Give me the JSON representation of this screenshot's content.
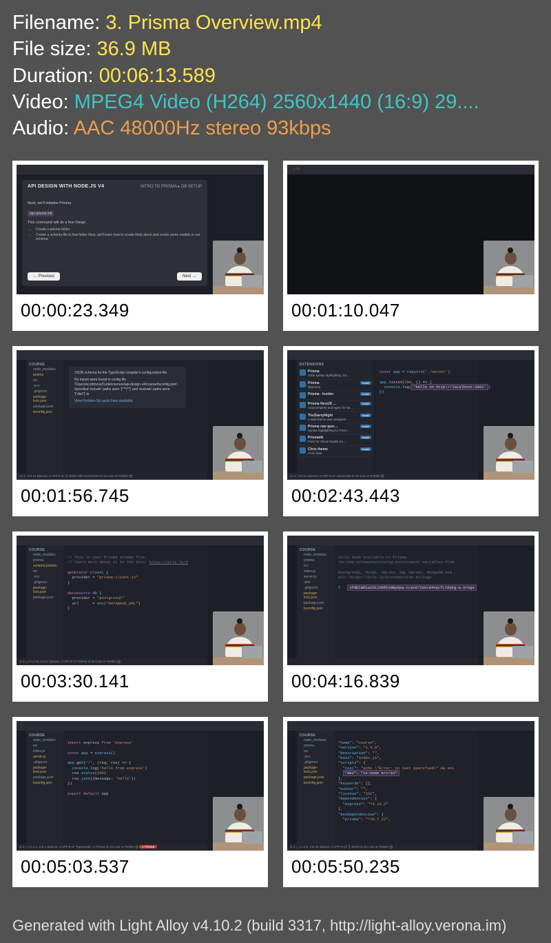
{
  "header": {
    "filename_label": "Filename: ",
    "filename_value": "3. Prisma Overview.mp4",
    "filesize_label": "File size: ",
    "filesize_value": "36.9 MB",
    "duration_label": "Duration: ",
    "duration_value": "00:06:13.589",
    "video_label": "Video: ",
    "video_value": "MPEG4 Video (H264) 2560x1440 (16:9) 29....",
    "audio_label": "Audio: ",
    "audio_value": "AAC 48000Hz stereo 93kbps"
  },
  "slide1": {
    "title": "API DESIGN WITH NODE.JS V4",
    "crumb": "INTRO TO PRISMA ▸ DB SETUP",
    "subtitle": "Next, we'll initalize Prisma",
    "cmd": "npx prisma init",
    "lead": "This command will do a few things:",
    "li1": "Create a prisma folder",
    "li2": "Create a schema file in that folder Next, we'll learn how to create think about and create some models in our schema",
    "prev": "← Previous",
    "next": "Next →"
  },
  "slide2": {
    "term": "~ %"
  },
  "slide3": {
    "tooltip_title": "JSON schema for the TypeScript compiler's configuration file",
    "tooltip_body1": "No inputs were found in config file '/Users/scottmoss/Code/courses/api-design-v4/course/tsconfig.json'. Specified 'include' paths were '[\"**/*\"]' and 'exclude' paths were '[\"dist\"]'.ts",
    "tooltip_link": "View Problem   No quick fixes available",
    "status": "Ln 4, Col 14   Spaces: 2   UTF-8   LF   {} JSON with Comments   ⊘ Go Live   ⊘ Prettier   ⨁"
  },
  "slide4": {
    "ext_header": "EXTENSIONS",
    "items": [
      {
        "name": "Prisma",
        "desc": "Adds syntax highlighting, for…",
        "btn": ""
      },
      {
        "name": "Prisma",
        "desc": "@prisma",
        "btn": "Install"
      },
      {
        "name": "Prisma - Insider",
        "desc": "",
        "btn": "Install"
      },
      {
        "name": "Prisma NestJS …",
        "desc": "Autocomplete and types for Ne…",
        "btn": "Install"
      },
      {
        "name": "TheStarryNight",
        "desc": "A dark theme was designed …",
        "btn": "Install"
      },
      {
        "name": "Prisma raw quer…",
        "desc": "Syntax highlighting for Prism…",
        "btn": "Install"
      },
      {
        "name": "Prismatik",
        "desc": "Pairs for Visual Studio Co…",
        "btn": "Install"
      },
      {
        "name": "Chris theme",
        "desc": "Chris dark",
        "btn": "Install"
      }
    ],
    "code_l1": "const app = require('./server')",
    "code_l2": "app.listen(200, () => {",
    "code_l3": "  console.log('hello on http://localhost:3001')",
    "code_l4": "})",
    "status": "Ln 4, Col 14   Spaces: 2   UTF-8   LF   JavaScript   ⊘ Go Live   ⊘ Prettier   ⨁"
  },
  "slide5": {
    "code": "// prisma > schema.prisma\n// This is your Prisma schema file,\n// learn more about it in the docs: https://pris.ly/d\n\ngenerator client {\n  provider = \"prisma-client-js\"\n}\n\ndatasource db {\n  provider = \"postgresql\"\n  url      = env(\"DATABASE_URL\")\n}",
    "status": "⊘ 0 △ 0   Ln 14, Col 2   Spaces: 2   UTF-8   LF   Prisma   ⊘ Go Live   ⊘ Prettier   ⨁"
  },
  "slide6": {
    "code_top": "cally made available to Prisma.\n/prisma-schema#accessing-environment-variables-from-\n\nPostgreSQL, MySQL, SQLite, SQL Server, MongoDB and …\nons: https://pris.ly/d/connection-strings",
    "code_line": "7   zPdECmRSa2UXJ28RInmBp9pq-ccps672enc84nacfcl8qkg-a.orego",
    "status": ""
  },
  "slide7": {
    "code": "import express from 'express'\n\nconst app = express()\n\napp.get('/', (req, res) => {\n  console.log('hello from express')\n  res.status(200)\n  res.json({message: 'hello'})\n})\n\nexport default app",
    "status": "⊘ 0 △ 0   Ln 1, Col 1   Spaces: 2   UTF-8   LF   TypeScript   ! 1 Prisma   ⊘ Go Live   ⊘ Prettier   ⨁",
    "prisma_badge": "1 Prisma"
  },
  "slide8": {
    "code": "\"name\": \"course\",\n\"version\": \"1.0.0\",\n\"description\": \"\",\n\"main\": \"index.js\",\n\"scripts\": {\n  \"test\": \"echo \\\"Error: no test specified\\\" && exi\n  \"dev\": \"ts-node src/in\"\n},\n\"keywords\": [],\n\"author\": \"\",\n\"license\": \"ISC\",\n\"dependencies\": {\n  \"express\": \"^4.18.2\"\n},\n\"devDependencies\": {\n  \"prisma\": \"^10.7.23\",",
    "status": "⊘ 0 △ 1   Ln 8, Col 28   Spaces: 2   UTF-8   LF   {} JSON   ⊘ Go Live   ⊘ Prettier   ⨁"
  },
  "tree": {
    "label": "COURSE",
    "node_modules": "node_modules",
    "prisma": "prisma",
    "src": "src",
    "index": "index.js",
    "server": "server.js",
    "env": ".env",
    "gitignore": ".gitignore",
    "pkglock": "package-lock.json",
    "pkg": "package.json",
    "tsconfig": "tsconfig.json",
    "schema": "schema.prisma"
  },
  "timestamps": [
    "00:00:23.349",
    "00:01:10.047",
    "00:01:56.745",
    "00:02:43.443",
    "00:03:30.141",
    "00:04:16.839",
    "00:05:03.537",
    "00:05:50.235"
  ],
  "footer": "Generated with Light Alloy v4.10.2 (build 3317, http://light-alloy.verona.im)"
}
